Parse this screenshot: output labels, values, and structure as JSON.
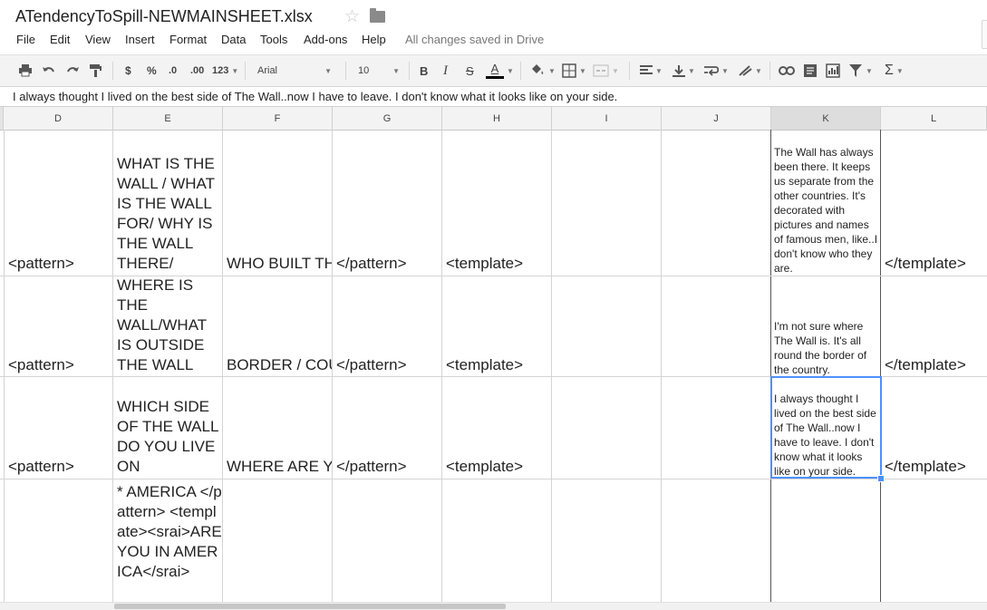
{
  "doc": {
    "title": "ATendencyToSpill-NEWMAINSHEET.xlsx"
  },
  "menu": [
    "File",
    "Edit",
    "View",
    "Insert",
    "Format",
    "Data",
    "Tools",
    "Add-ons",
    "Help"
  ],
  "status": "All changes saved in Drive",
  "toolbar": {
    "currency": "$",
    "percent": "%",
    "dec_decrease": ".0",
    "dec_increase": ".00",
    "more_formats": "123",
    "font": "Arial",
    "size": "10",
    "bold": "B",
    "italic": "I",
    "strike": "S",
    "text_color": "A",
    "functions": "Σ",
    "accent": "#4d90fe"
  },
  "formula_bar": {
    "value": "I always thought I lived on the best side of The Wall..now I have to leave. I don't know what it looks like on your side."
  },
  "columns": [
    "D",
    "E",
    "F",
    "G",
    "H",
    "I",
    "J",
    "K",
    "L"
  ],
  "rows": [
    {
      "D": "<pattern>",
      "E": "WHAT IS THE WALL / WHAT IS THE WALL FOR/ WHY IS THE WALL THERE/",
      "F": "WHO BUILT THE WALL",
      "G": "</pattern>",
      "H": "<template>",
      "K": "The Wall has always been there. It keeps us separate from the other countries. It's decorated with pictures and names of famous men, like..I don't know who they are.",
      "L": "</template>"
    },
    {
      "D": "<pattern>",
      "E": "WHERE IS THE WALL/WHAT IS OUTSIDE THE WALL",
      "F": "BORDER / COUNTRY",
      "G": "</pattern>",
      "H": "<template>",
      "K": "I'm not sure where The Wall is. It's all round the border of the country.",
      "L": "</template>"
    },
    {
      "D": "<pattern>",
      "E": "WHICH SIDE OF THE WALL DO YOU LIVE ON",
      "F": "WHERE ARE YOU",
      "G": "</pattern>",
      "H": "<template>",
      "K": "I always thought I lived on the best side of The Wall..now I have to leave. I don't know what it looks like on your side.",
      "L": "</template>"
    },
    {
      "E": "* AMERICA </pattern> <template><srai>ARE YOU IN AMERICA</srai>"
    }
  ]
}
